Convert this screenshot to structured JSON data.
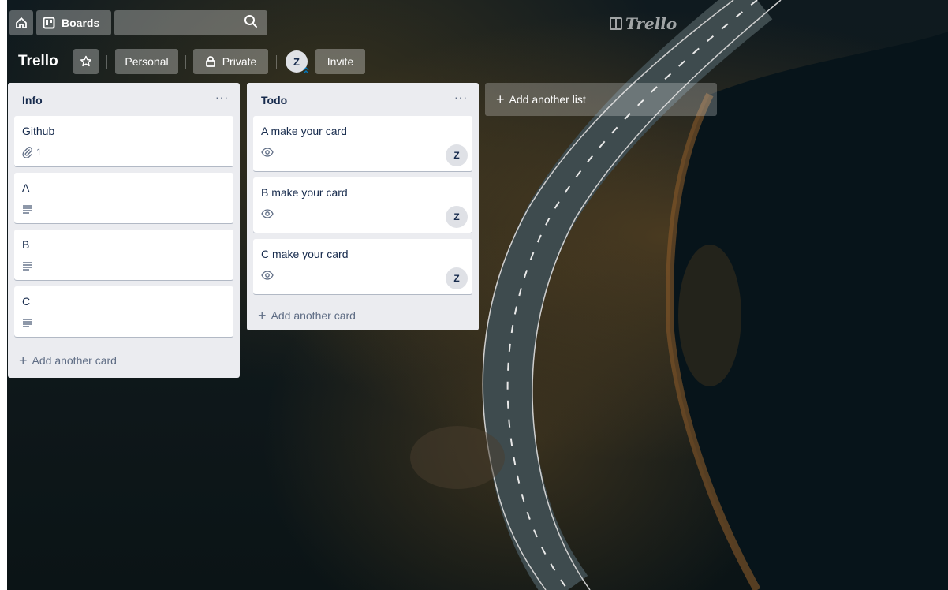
{
  "header": {
    "boards_label": "Boards",
    "search_placeholder": "",
    "logo_text": "Trello"
  },
  "board": {
    "title": "Trello",
    "personal_label": "Personal",
    "private_label": "Private",
    "member_initial": "Z",
    "invite_label": "Invite"
  },
  "lists": [
    {
      "title": "Info",
      "menu": "···",
      "cards": [
        {
          "title": "Github",
          "badge_icon": "attachment-icon",
          "badge_count": "1"
        },
        {
          "title": "A",
          "badge_icon": "description-icon"
        },
        {
          "title": "B",
          "badge_icon": "description-icon"
        },
        {
          "title": "C",
          "badge_icon": "description-icon"
        }
      ],
      "add_card_label": "Add another card"
    },
    {
      "title": "Todo",
      "menu": "···",
      "cards": [
        {
          "title": "A make your card",
          "badge_icon": "watch-icon",
          "member": "Z"
        },
        {
          "title": "B make your card",
          "badge_icon": "watch-icon",
          "member": "Z"
        },
        {
          "title": "C make your card",
          "badge_icon": "watch-icon",
          "member": "Z"
        }
      ],
      "add_card_label": "Add another card"
    }
  ],
  "add_list_label": "Add another list",
  "colors": {
    "list_bg": "#ebecf0",
    "card_bg": "#ffffff",
    "text": "#172b4d",
    "muted": "#5e6c84"
  }
}
